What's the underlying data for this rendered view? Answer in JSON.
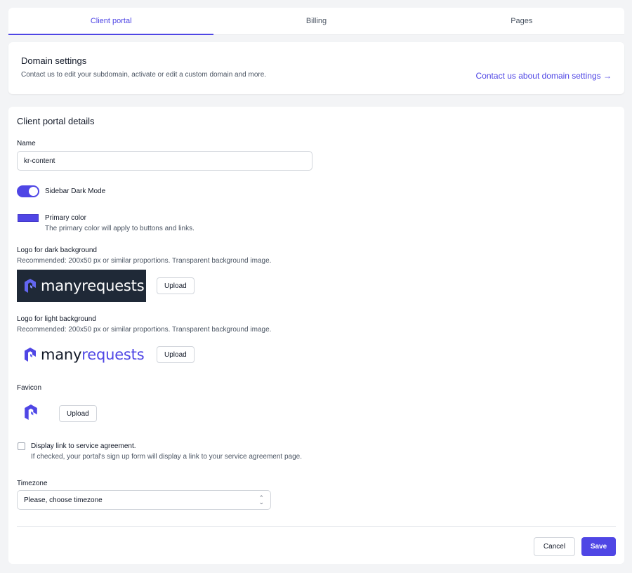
{
  "tabs": [
    {
      "label": "Client portal",
      "active": true
    },
    {
      "label": "Billing",
      "active": false
    },
    {
      "label": "Pages",
      "active": false
    }
  ],
  "domain": {
    "title": "Domain settings",
    "description": "Contact us to edit your subdomain, activate or edit a custom domain and more.",
    "link": "Contact us about domain settings →"
  },
  "details": {
    "title": "Client portal details",
    "name_label": "Name",
    "name_value": "kr-content",
    "dark_mode_label": "Sidebar Dark Mode",
    "dark_mode_on": true,
    "primary_color_label": "Primary color",
    "primary_color_hint": "The primary color will apply to buttons and links.",
    "primary_color": "#5046e5",
    "logo_dark_label": "Logo for dark background",
    "logo_dark_hint": "Recommended: 200x50 px or similar proportions. Transparent background image.",
    "logo_light_label": "Logo for light background",
    "logo_light_hint": "Recommended: 200x50 px or similar proportions. Transparent background image.",
    "logo_text_a": "many",
    "logo_text_b": "requests",
    "favicon_label": "Favicon",
    "upload_label": "Upload",
    "agreement_label": "Display link to service agreement.",
    "agreement_hint": "If checked, your portal's sign up form will display a link to your service agreement page.",
    "agreement_checked": false,
    "timezone_label": "Timezone",
    "timezone_value": "Please, choose timezone"
  },
  "actions": {
    "cancel": "Cancel",
    "save": "Save"
  },
  "colors": {
    "accent": "#4f46e5",
    "logo_dark_bg": "#1f2937"
  }
}
